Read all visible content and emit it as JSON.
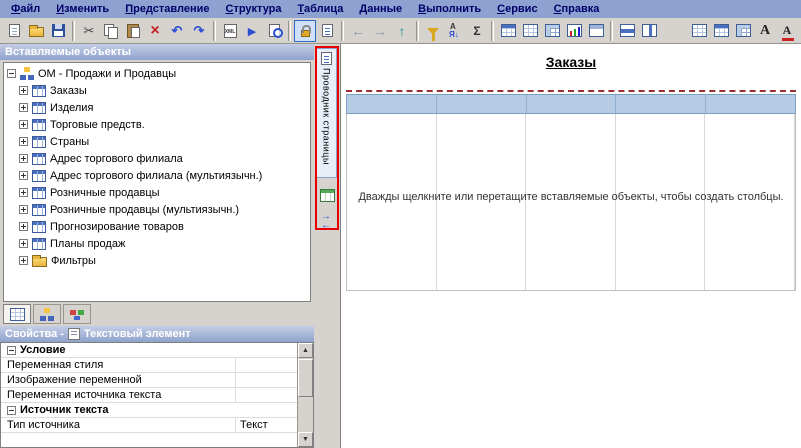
{
  "colors": {
    "menu_bar": "#8da2d0",
    "toolbar": "#d6d3ce",
    "panel_header": "#9fb2d6",
    "table_header": "#b6cce4",
    "page_divider": "#9c3030",
    "annotation_highlight": "#e80000",
    "pressed_button_accent": "#316ac5"
  },
  "menu_bar": {
    "items": [
      "Файл",
      "Изменить",
      "Представление",
      "Структура",
      "Таблица",
      "Данные",
      "Выполнить",
      "Сервис",
      "Справка"
    ]
  },
  "toolbar": {
    "buttons": [
      "new-report",
      "open",
      "save",
      "cut",
      "copy",
      "paste",
      "delete",
      "undo",
      "redo",
      "xml-view",
      "run-report",
      "report-viewer",
      "lock-page-objects",
      "page-preview",
      "back",
      "forward",
      "go-up",
      "filter",
      "sort",
      "summarize",
      "insert-table",
      "insert-list",
      "insert-crosstab",
      "insert-chart",
      "insert-section",
      "merge-cells",
      "split-cells",
      "table-grid",
      "headers-footers",
      "table-style",
      "font",
      "font-color"
    ],
    "pressed": "lock-page-objects"
  },
  "objects_panel": {
    "title": "Вставляемые объекты",
    "tree": {
      "root": "ОМ - Продажи и Продавцы",
      "items": [
        "Заказы",
        "Изделия",
        "Торговые предств.",
        "Страны",
        "Адрес торгового филиала",
        "Адрес торгового филиала (мультиязычн.)",
        "Розничные продавцы",
        "Розничные продавцы (мультиязычн.)",
        "Прогнозирование товаров",
        "Планы продаж",
        "Фильтры"
      ]
    },
    "tabs": [
      "source-tab",
      "data-items-tab",
      "toolbox-tab"
    ]
  },
  "page_explorer": {
    "label": "Проводник страницы",
    "buttons": [
      "query-explorer",
      "condition-explorer"
    ]
  },
  "properties_panel": {
    "title_prefix": "Свойства -",
    "selected_item": "Текстовый элемент",
    "rows": [
      {
        "label": "Условие",
        "value": "",
        "section": true
      },
      {
        "label": "Переменная стиля",
        "value": ""
      },
      {
        "label": "Изображение переменной",
        "value": ""
      },
      {
        "label": "Переменная источника текста",
        "value": ""
      },
      {
        "label": "Источник текста",
        "value": "",
        "section": true
      },
      {
        "label": "Тип источника",
        "value": "Текст"
      }
    ]
  },
  "canvas": {
    "title": "Заказы",
    "placeholder": "Дважды щелкните или перетащите вставляемые объекты, чтобы создать столбцы.",
    "column_count": 5
  }
}
